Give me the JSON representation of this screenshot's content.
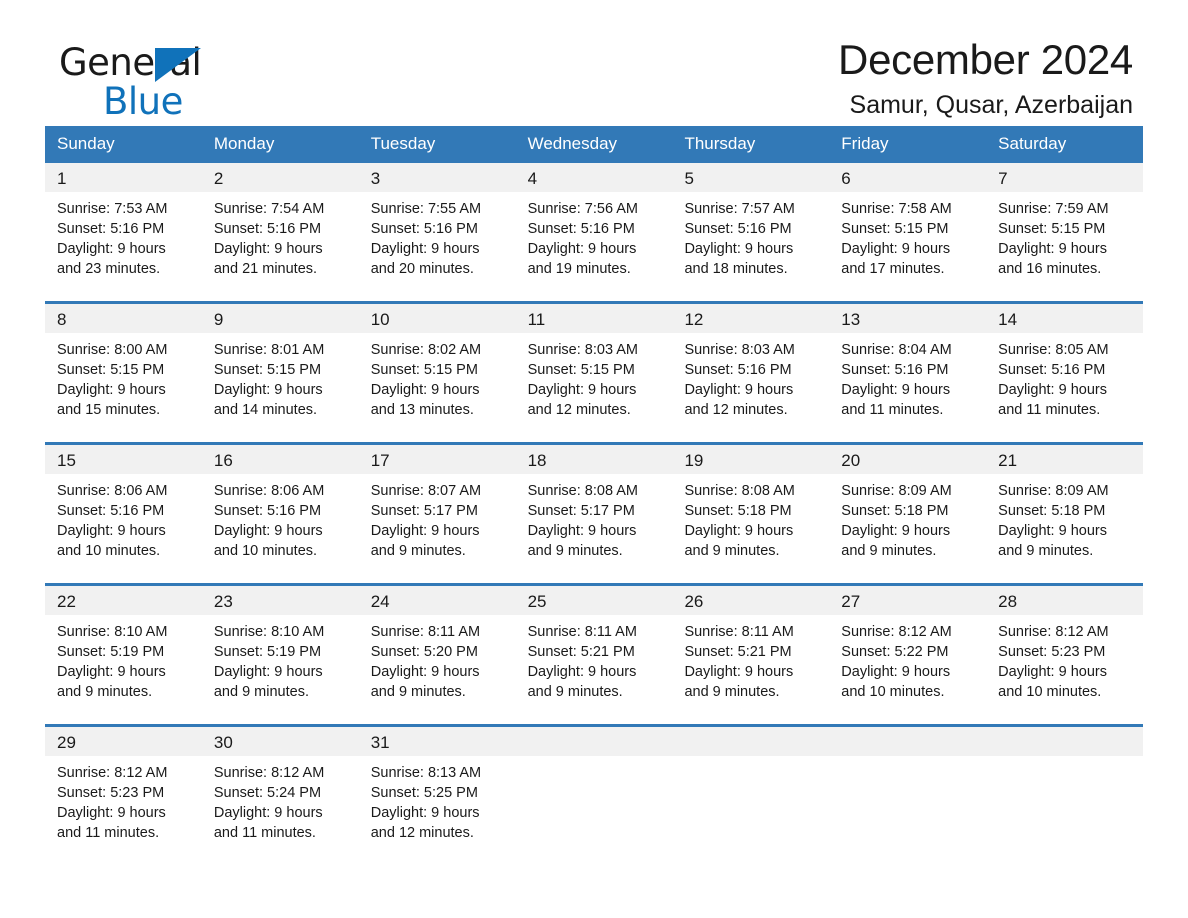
{
  "brand": {
    "line1": "General",
    "line2": "Blue",
    "triangle_color": "#1072ba"
  },
  "header": {
    "title": "December 2024",
    "subtitle": "Samur, Qusar, Azerbaijan",
    "accent_color": "#3279b7",
    "band_color": "#f1f1f1"
  },
  "weekdays": [
    "Sunday",
    "Monday",
    "Tuesday",
    "Wednesday",
    "Thursday",
    "Friday",
    "Saturday"
  ],
  "weeks": [
    {
      "days": [
        {
          "num": "1",
          "sunrise": "Sunrise: 7:53 AM",
          "sunset": "Sunset: 5:16 PM",
          "daylight1": "Daylight: 9 hours",
          "daylight2": "and 23 minutes."
        },
        {
          "num": "2",
          "sunrise": "Sunrise: 7:54 AM",
          "sunset": "Sunset: 5:16 PM",
          "daylight1": "Daylight: 9 hours",
          "daylight2": "and 21 minutes."
        },
        {
          "num": "3",
          "sunrise": "Sunrise: 7:55 AM",
          "sunset": "Sunset: 5:16 PM",
          "daylight1": "Daylight: 9 hours",
          "daylight2": "and 20 minutes."
        },
        {
          "num": "4",
          "sunrise": "Sunrise: 7:56 AM",
          "sunset": "Sunset: 5:16 PM",
          "daylight1": "Daylight: 9 hours",
          "daylight2": "and 19 minutes."
        },
        {
          "num": "5",
          "sunrise": "Sunrise: 7:57 AM",
          "sunset": "Sunset: 5:16 PM",
          "daylight1": "Daylight: 9 hours",
          "daylight2": "and 18 minutes."
        },
        {
          "num": "6",
          "sunrise": "Sunrise: 7:58 AM",
          "sunset": "Sunset: 5:15 PM",
          "daylight1": "Daylight: 9 hours",
          "daylight2": "and 17 minutes."
        },
        {
          "num": "7",
          "sunrise": "Sunrise: 7:59 AM",
          "sunset": "Sunset: 5:15 PM",
          "daylight1": "Daylight: 9 hours",
          "daylight2": "and 16 minutes."
        }
      ]
    },
    {
      "days": [
        {
          "num": "8",
          "sunrise": "Sunrise: 8:00 AM",
          "sunset": "Sunset: 5:15 PM",
          "daylight1": "Daylight: 9 hours",
          "daylight2": "and 15 minutes."
        },
        {
          "num": "9",
          "sunrise": "Sunrise: 8:01 AM",
          "sunset": "Sunset: 5:15 PM",
          "daylight1": "Daylight: 9 hours",
          "daylight2": "and 14 minutes."
        },
        {
          "num": "10",
          "sunrise": "Sunrise: 8:02 AM",
          "sunset": "Sunset: 5:15 PM",
          "daylight1": "Daylight: 9 hours",
          "daylight2": "and 13 minutes."
        },
        {
          "num": "11",
          "sunrise": "Sunrise: 8:03 AM",
          "sunset": "Sunset: 5:15 PM",
          "daylight1": "Daylight: 9 hours",
          "daylight2": "and 12 minutes."
        },
        {
          "num": "12",
          "sunrise": "Sunrise: 8:03 AM",
          "sunset": "Sunset: 5:16 PM",
          "daylight1": "Daylight: 9 hours",
          "daylight2": "and 12 minutes."
        },
        {
          "num": "13",
          "sunrise": "Sunrise: 8:04 AM",
          "sunset": "Sunset: 5:16 PM",
          "daylight1": "Daylight: 9 hours",
          "daylight2": "and 11 minutes."
        },
        {
          "num": "14",
          "sunrise": "Sunrise: 8:05 AM",
          "sunset": "Sunset: 5:16 PM",
          "daylight1": "Daylight: 9 hours",
          "daylight2": "and 11 minutes."
        }
      ]
    },
    {
      "days": [
        {
          "num": "15",
          "sunrise": "Sunrise: 8:06 AM",
          "sunset": "Sunset: 5:16 PM",
          "daylight1": "Daylight: 9 hours",
          "daylight2": "and 10 minutes."
        },
        {
          "num": "16",
          "sunrise": "Sunrise: 8:06 AM",
          "sunset": "Sunset: 5:16 PM",
          "daylight1": "Daylight: 9 hours",
          "daylight2": "and 10 minutes."
        },
        {
          "num": "17",
          "sunrise": "Sunrise: 8:07 AM",
          "sunset": "Sunset: 5:17 PM",
          "daylight1": "Daylight: 9 hours",
          "daylight2": "and 9 minutes."
        },
        {
          "num": "18",
          "sunrise": "Sunrise: 8:08 AM",
          "sunset": "Sunset: 5:17 PM",
          "daylight1": "Daylight: 9 hours",
          "daylight2": "and 9 minutes."
        },
        {
          "num": "19",
          "sunrise": "Sunrise: 8:08 AM",
          "sunset": "Sunset: 5:18 PM",
          "daylight1": "Daylight: 9 hours",
          "daylight2": "and 9 minutes."
        },
        {
          "num": "20",
          "sunrise": "Sunrise: 8:09 AM",
          "sunset": "Sunset: 5:18 PM",
          "daylight1": "Daylight: 9 hours",
          "daylight2": "and 9 minutes."
        },
        {
          "num": "21",
          "sunrise": "Sunrise: 8:09 AM",
          "sunset": "Sunset: 5:18 PM",
          "daylight1": "Daylight: 9 hours",
          "daylight2": "and 9 minutes."
        }
      ]
    },
    {
      "days": [
        {
          "num": "22",
          "sunrise": "Sunrise: 8:10 AM",
          "sunset": "Sunset: 5:19 PM",
          "daylight1": "Daylight: 9 hours",
          "daylight2": "and 9 minutes."
        },
        {
          "num": "23",
          "sunrise": "Sunrise: 8:10 AM",
          "sunset": "Sunset: 5:19 PM",
          "daylight1": "Daylight: 9 hours",
          "daylight2": "and 9 minutes."
        },
        {
          "num": "24",
          "sunrise": "Sunrise: 8:11 AM",
          "sunset": "Sunset: 5:20 PM",
          "daylight1": "Daylight: 9 hours",
          "daylight2": "and 9 minutes."
        },
        {
          "num": "25",
          "sunrise": "Sunrise: 8:11 AM",
          "sunset": "Sunset: 5:21 PM",
          "daylight1": "Daylight: 9 hours",
          "daylight2": "and 9 minutes."
        },
        {
          "num": "26",
          "sunrise": "Sunrise: 8:11 AM",
          "sunset": "Sunset: 5:21 PM",
          "daylight1": "Daylight: 9 hours",
          "daylight2": "and 9 minutes."
        },
        {
          "num": "27",
          "sunrise": "Sunrise: 8:12 AM",
          "sunset": "Sunset: 5:22 PM",
          "daylight1": "Daylight: 9 hours",
          "daylight2": "and 10 minutes."
        },
        {
          "num": "28",
          "sunrise": "Sunrise: 8:12 AM",
          "sunset": "Sunset: 5:23 PM",
          "daylight1": "Daylight: 9 hours",
          "daylight2": "and 10 minutes."
        }
      ]
    },
    {
      "days": [
        {
          "num": "29",
          "sunrise": "Sunrise: 8:12 AM",
          "sunset": "Sunset: 5:23 PM",
          "daylight1": "Daylight: 9 hours",
          "daylight2": "and 11 minutes."
        },
        {
          "num": "30",
          "sunrise": "Sunrise: 8:12 AM",
          "sunset": "Sunset: 5:24 PM",
          "daylight1": "Daylight: 9 hours",
          "daylight2": "and 11 minutes."
        },
        {
          "num": "31",
          "sunrise": "Sunrise: 8:13 AM",
          "sunset": "Sunset: 5:25 PM",
          "daylight1": "Daylight: 9 hours",
          "daylight2": "and 12 minutes."
        },
        {
          "num": "",
          "sunrise": "",
          "sunset": "",
          "daylight1": "",
          "daylight2": ""
        },
        {
          "num": "",
          "sunrise": "",
          "sunset": "",
          "daylight1": "",
          "daylight2": ""
        },
        {
          "num": "",
          "sunrise": "",
          "sunset": "",
          "daylight1": "",
          "daylight2": ""
        },
        {
          "num": "",
          "sunrise": "",
          "sunset": "",
          "daylight1": "",
          "daylight2": ""
        }
      ]
    }
  ]
}
